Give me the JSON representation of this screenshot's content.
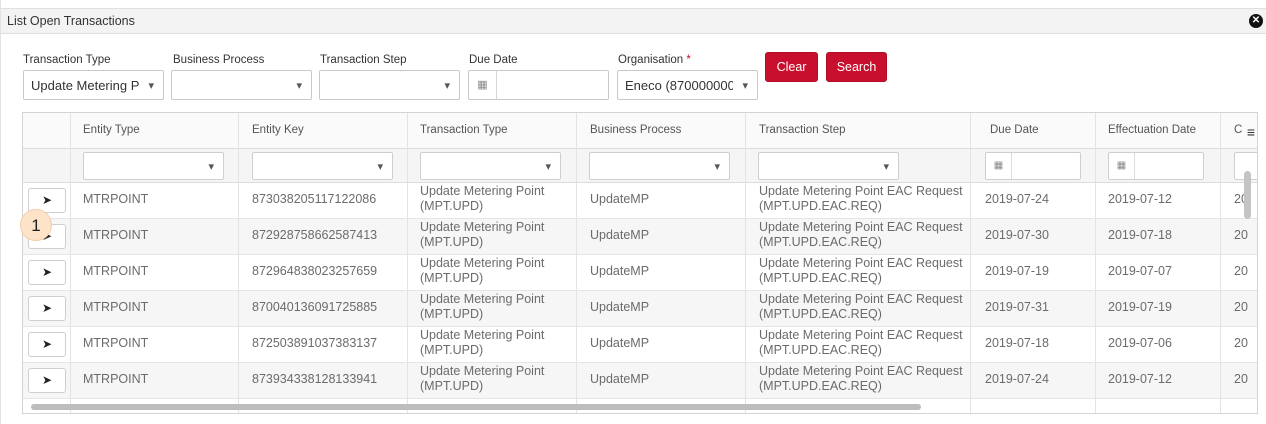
{
  "panel": {
    "title": "List Open Transactions"
  },
  "filters": {
    "transaction_type": {
      "label": "Transaction Type",
      "value": "Update Metering P"
    },
    "business_process": {
      "label": "Business Process",
      "value": ""
    },
    "transaction_step": {
      "label": "Transaction Step",
      "value": ""
    },
    "due_date": {
      "label": "Due Date",
      "value": ""
    },
    "organisation": {
      "label": "Organisation",
      "required_mark": "*",
      "value": "Eneco (8700000000"
    },
    "clear_label": "Clear",
    "search_label": "Search"
  },
  "grid": {
    "columns": [
      "Entity Type",
      "Entity Key",
      "Transaction Type",
      "Business Process",
      "Transaction Step",
      "Due Date",
      "Effectuation Date",
      "C"
    ],
    "rows": [
      {
        "entity_type": "MTRPOINT",
        "entity_key": "873038205117122086",
        "transaction_type_l1": "Update Metering Point",
        "transaction_type_l2": "(MPT.UPD)",
        "business_process": "UpdateMP",
        "transaction_step_l1": "Update Metering Point EAC Request",
        "transaction_step_l2": "(MPT.UPD.EAC.REQ)",
        "due_date": "2019-07-24",
        "effectuation_date": "2019-07-12",
        "created": "20"
      },
      {
        "entity_type": "MTRPOINT",
        "entity_key": "872928758662587413",
        "transaction_type_l1": "Update Metering Point",
        "transaction_type_l2": "(MPT.UPD)",
        "business_process": "UpdateMP",
        "transaction_step_l1": "Update Metering Point EAC Request",
        "transaction_step_l2": "(MPT.UPD.EAC.REQ)",
        "due_date": "2019-07-30",
        "effectuation_date": "2019-07-18",
        "created": "20"
      },
      {
        "entity_type": "MTRPOINT",
        "entity_key": "872964838023257659",
        "transaction_type_l1": "Update Metering Point",
        "transaction_type_l2": "(MPT.UPD)",
        "business_process": "UpdateMP",
        "transaction_step_l1": "Update Metering Point EAC Request",
        "transaction_step_l2": "(MPT.UPD.EAC.REQ)",
        "due_date": "2019-07-19",
        "effectuation_date": "2019-07-07",
        "created": "20"
      },
      {
        "entity_type": "MTRPOINT",
        "entity_key": "870040136091725885",
        "transaction_type_l1": "Update Metering Point",
        "transaction_type_l2": "(MPT.UPD)",
        "business_process": "UpdateMP",
        "transaction_step_l1": "Update Metering Point EAC Request",
        "transaction_step_l2": "(MPT.UPD.EAC.REQ)",
        "due_date": "2019-07-31",
        "effectuation_date": "2019-07-19",
        "created": "20"
      },
      {
        "entity_type": "MTRPOINT",
        "entity_key": "872503891037383137",
        "transaction_type_l1": "Update Metering Point",
        "transaction_type_l2": "(MPT.UPD)",
        "business_process": "UpdateMP",
        "transaction_step_l1": "Update Metering Point EAC Request",
        "transaction_step_l2": "(MPT.UPD.EAC.REQ)",
        "due_date": "2019-07-18",
        "effectuation_date": "2019-07-06",
        "created": "20"
      },
      {
        "entity_type": "MTRPOINT",
        "entity_key": "873934338128133941",
        "transaction_type_l1": "Update Metering Point",
        "transaction_type_l2": "(MPT.UPD)",
        "business_process": "UpdateMP",
        "transaction_step_l1": "Update Metering Point EAC Request",
        "transaction_step_l2": "(MPT.UPD.EAC.REQ)",
        "due_date": "2019-07-24",
        "effectuation_date": "2019-07-12",
        "created": "20"
      }
    ]
  },
  "icons": {
    "close": "close-icon",
    "chevron": "chevron-down-icon",
    "calendar": "calendar-icon",
    "send": "send-icon",
    "menu": "column-menu-icon"
  },
  "marker": {
    "label": "1"
  },
  "colors": {
    "accent": "#c8102e",
    "marker": "#fde3c8"
  }
}
